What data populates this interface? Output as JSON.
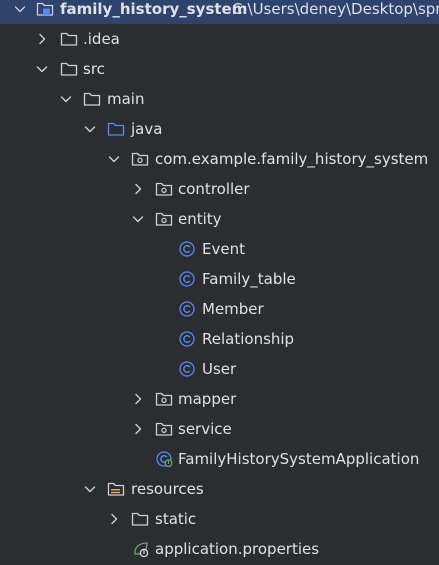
{
  "colors": {
    "background": "#2b2d30",
    "selection": "#2e436e",
    "text": "#dfe1e5",
    "folder_outline": "#ced0d6",
    "source_folder": "#548af7",
    "class_icon": "#548af7",
    "spring_icon": "#6aab73"
  },
  "tree": {
    "root": {
      "label": "family_history_system",
      "path": "C:\\Users\\deney\\Desktop\\spr",
      "icon": "module-folder-icon"
    },
    "idea": {
      "label": ".idea",
      "icon": "folder-icon"
    },
    "src": {
      "label": "src",
      "icon": "folder-icon"
    },
    "main": {
      "label": "main",
      "icon": "folder-icon"
    },
    "java": {
      "label": "java",
      "icon": "source-folder-icon"
    },
    "package": {
      "label": "com.example.family_history_system",
      "icon": "package-icon"
    },
    "controller": {
      "label": "controller",
      "icon": "package-icon"
    },
    "entity": {
      "label": "entity",
      "icon": "package-icon"
    },
    "event": {
      "label": "Event",
      "icon": "class-icon"
    },
    "family_table": {
      "label": "Family_table",
      "icon": "class-icon"
    },
    "member": {
      "label": "Member",
      "icon": "class-icon"
    },
    "relationship": {
      "label": "Relationship",
      "icon": "class-icon"
    },
    "user": {
      "label": "User",
      "icon": "class-icon"
    },
    "mapper": {
      "label": "mapper",
      "icon": "package-icon"
    },
    "service": {
      "label": "service",
      "icon": "package-icon"
    },
    "app": {
      "label": "FamilyHistorySystemApplication",
      "icon": "spring-boot-class-icon"
    },
    "resources": {
      "label": "resources",
      "icon": "resources-folder-icon"
    },
    "static": {
      "label": "static",
      "icon": "folder-icon"
    },
    "properties": {
      "label": "application.properties",
      "icon": "spring-properties-icon"
    }
  }
}
